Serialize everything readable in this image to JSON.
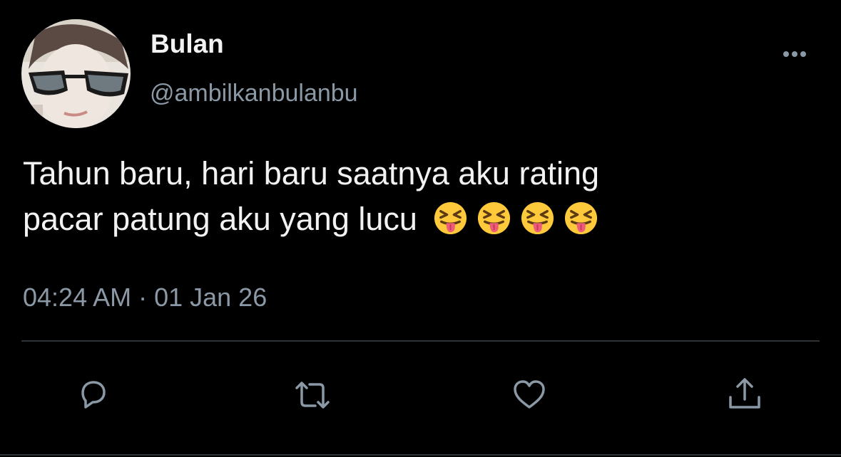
{
  "tweet": {
    "display_name": "Bulan",
    "handle": "@ambilkanbulanbu",
    "text_line1": "Tahun baru, hari baru saatnya aku rating",
    "text_line2": "pacar patung aku yang lucu",
    "emojis": [
      "squinting-face-with-tongue",
      "squinting-face-with-tongue",
      "squinting-face-with-tongue",
      "squinting-face-with-tongue"
    ],
    "timestamp": "04:24 AM · 01 Jan 26"
  },
  "actions": {
    "reply_icon": "reply-icon",
    "retweet_icon": "retweet-icon",
    "like_icon": "heart-icon",
    "share_icon": "share-icon",
    "more_icon": "more-options-icon"
  },
  "colors": {
    "background": "#000000",
    "primary_text": "#f2f2f2",
    "secondary_text": "#8b98a5",
    "divider": "#2f3336"
  }
}
